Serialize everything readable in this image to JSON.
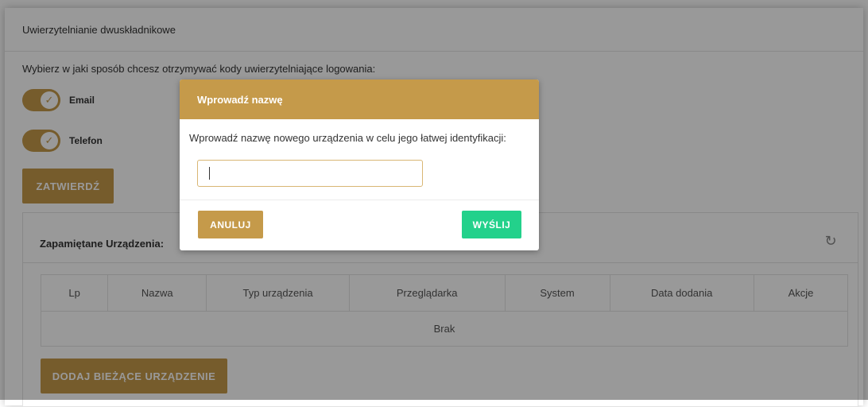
{
  "section": {
    "title": "Uwierzytelnianie dwuskładnikowe",
    "instruction": "Wybierz w jaki sposób chcesz otrzymywać kody uwierzytelniające logowania:",
    "toggles": [
      {
        "label": "Email",
        "checked": true
      },
      {
        "label": "Telefon",
        "checked": true
      }
    ],
    "confirm_label": "ZATWIERDŹ"
  },
  "devices": {
    "title": "Zapamiętane Urządzenia:",
    "columns": [
      "Lp",
      "Nazwa",
      "Typ urządzenia",
      "Przeglądarka",
      "System",
      "Data dodania",
      "Akcje"
    ],
    "empty_text": "Brak",
    "add_label": "DODAJ BIEŻĄCE URZĄDZENIE",
    "refresh_icon": "refresh-icon"
  },
  "modal": {
    "title": "Wprowadź nazwę",
    "text": "Wprowadź nazwę nowego urządzenia w celu jego łatwej identyfikacji:",
    "input_value": "",
    "cancel_label": "ANULUJ",
    "send_label": "WYŚLIJ"
  },
  "colors": {
    "accent": "#c59a4a",
    "success": "#23d18b"
  }
}
